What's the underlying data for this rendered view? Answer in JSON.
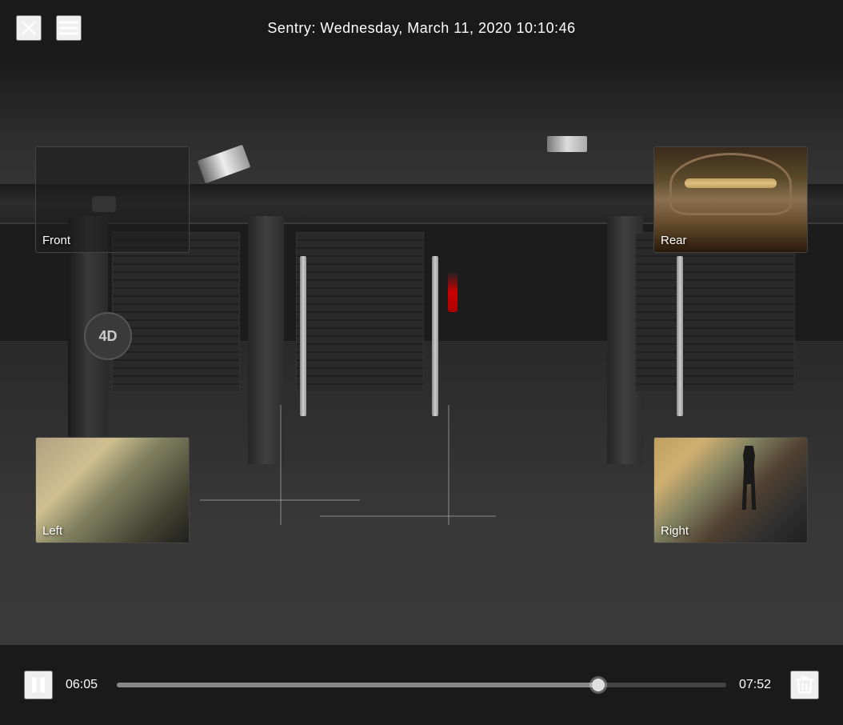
{
  "header": {
    "title": "Sentry: Wednesday, March 11, 2020 10:10:46",
    "close_label": "×",
    "menu_label": "≡"
  },
  "cameras": {
    "front": {
      "label": "Front",
      "position": "top-left"
    },
    "rear": {
      "label": "Rear",
      "position": "top-right"
    },
    "left": {
      "label": "Left",
      "position": "bottom-left"
    },
    "right": {
      "label": "Right",
      "position": "bottom-right"
    }
  },
  "controls": {
    "current_time": "06:05",
    "total_time": "07:52",
    "progress_percent": 79,
    "play_pause_icon": "pause-icon",
    "delete_icon": "trash-icon"
  },
  "scene": {
    "level_sign": "4D"
  }
}
